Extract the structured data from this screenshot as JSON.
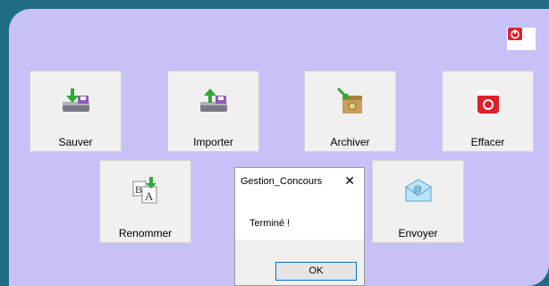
{
  "buttons": {
    "sauver": "Sauver",
    "importer": "Importer",
    "archiver": "Archiver",
    "effacer": "Effacer",
    "renommer": "Renommer",
    "envoyer": "Envoyer"
  },
  "dialog": {
    "title": "Gestion_Concours",
    "close": "✕",
    "message": "Terminé !",
    "ok": "OK"
  },
  "icons": {
    "power": "power-icon",
    "sauver": "save-drive-icon",
    "importer": "import-drive-icon",
    "archiver": "archive-box-icon",
    "effacer": "trash-icon",
    "renommer": "rename-icon",
    "envoyer": "email-icon"
  },
  "colors": {
    "panel": "#c6c2f7",
    "frame": "#1e6d85",
    "tile": "#f0f0f0",
    "accent_green": "#2fa836",
    "accent_red": "#e0202a"
  }
}
